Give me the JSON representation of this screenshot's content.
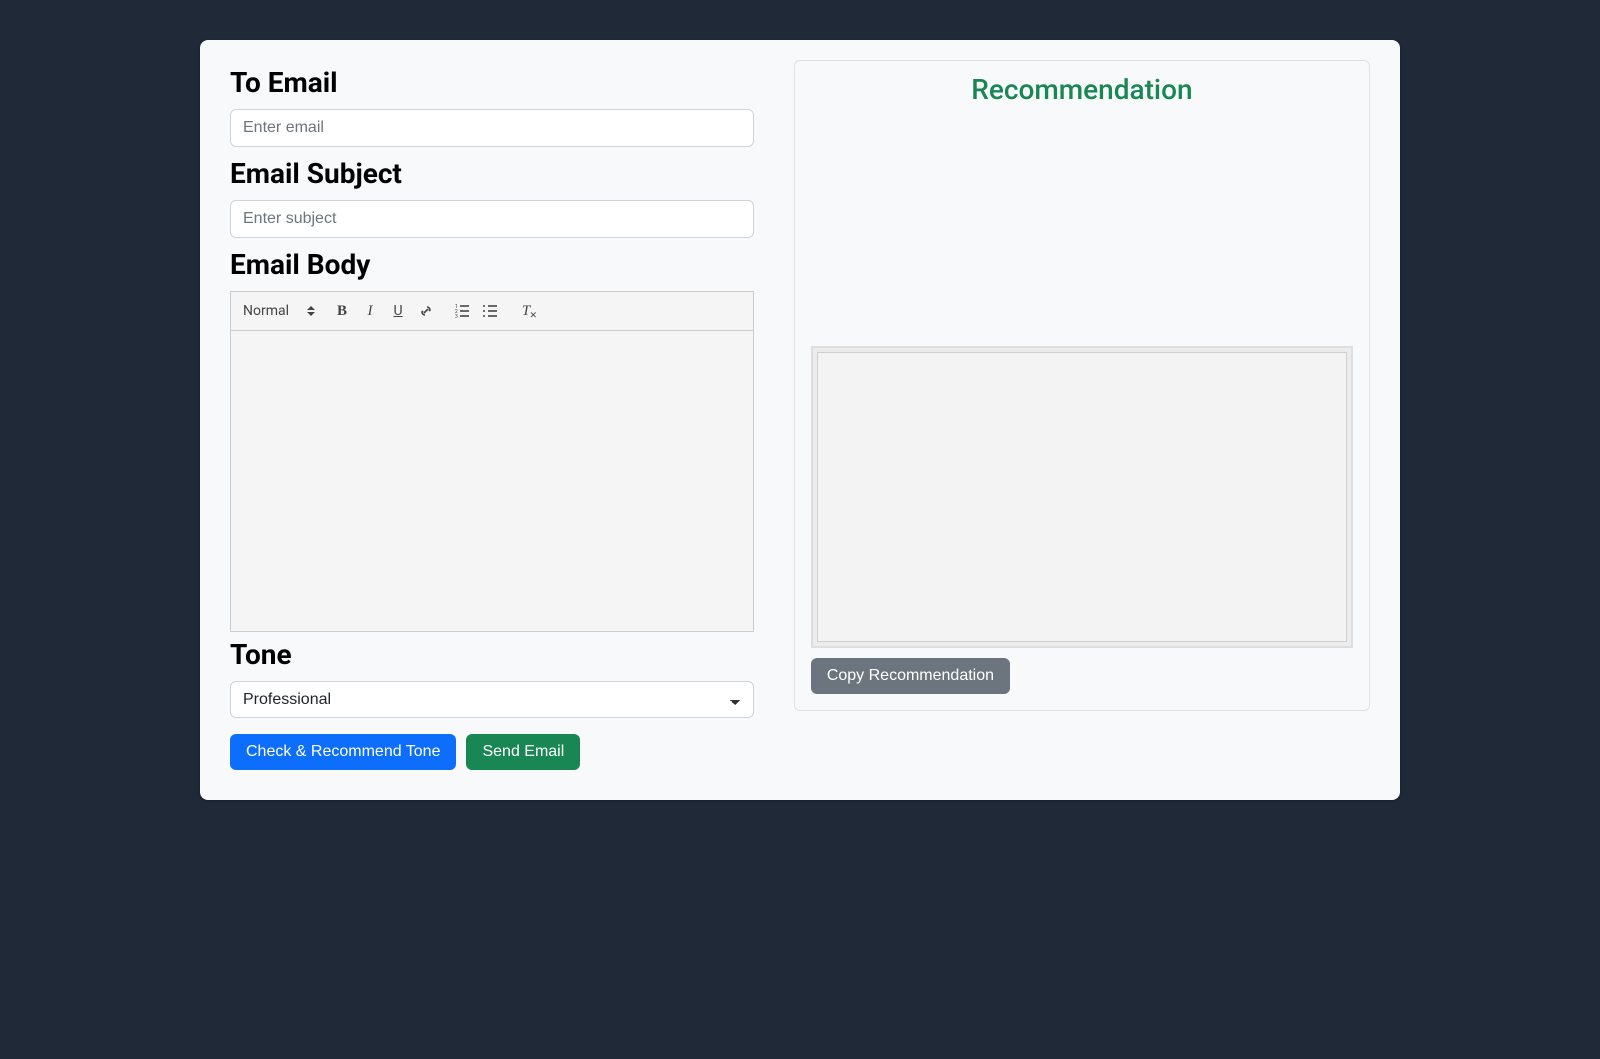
{
  "labels": {
    "to_email": "To Email",
    "email_subject": "Email Subject",
    "email_body": "Email Body",
    "tone": "Tone"
  },
  "inputs": {
    "to_email_placeholder": "Enter email",
    "to_email_value": "",
    "subject_placeholder": "Enter subject",
    "subject_value": "",
    "body_value": ""
  },
  "editor": {
    "heading_label": "Normal"
  },
  "tone": {
    "selected": "Professional"
  },
  "buttons": {
    "check": "Check & Recommend Tone",
    "send": "Send Email",
    "copy": "Copy Recommendation"
  },
  "recommendation": {
    "title": "Recommendation",
    "text": ""
  }
}
